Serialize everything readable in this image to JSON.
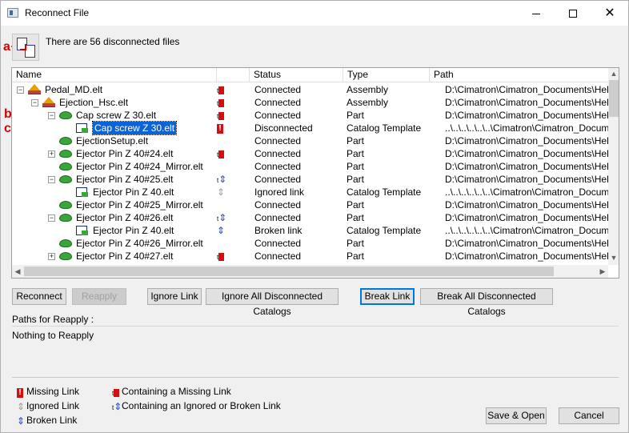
{
  "window": {
    "title": "Reconnect File",
    "minimize_glyph": "",
    "maximize_glyph": "",
    "close_glyph": "✕"
  },
  "annotations": {
    "a": "a",
    "b": "b",
    "c": "c"
  },
  "info_text": "There are 56 disconnected files",
  "columns": [
    "Name",
    "Status",
    "Type",
    "Path"
  ],
  "rows": [
    {
      "name": "Pedal_MD.elt",
      "level": 0,
      "expander": "−",
      "node_icon": "assembly-icon",
      "link_icon": "containing-missing-link-icon",
      "status": "Connected",
      "type": "Assembly",
      "path": "D:\\Cimatron\\Cimatron_Documents\\Help W"
    },
    {
      "name": "Ejection_Hsc.elt",
      "level": 1,
      "expander": "−",
      "node_icon": "assembly-icon",
      "link_icon": "containing-missing-link-icon",
      "status": "Connected",
      "type": "Assembly",
      "path": "D:\\Cimatron\\Cimatron_Documents\\Help W"
    },
    {
      "name": "Cap screw Z 30.elt",
      "level": 2,
      "expander": "−",
      "node_icon": "part-icon",
      "link_icon": "containing-missing-link-icon",
      "status": "Connected",
      "type": "Part",
      "path": "D:\\Cimatron\\Cimatron_Documents\\Help W"
    },
    {
      "name": "Cap screw Z 30.elt",
      "level": 3,
      "expander": "",
      "node_icon": "catalog-icon",
      "link_icon": "missing-link-icon",
      "status": "Disconnected",
      "type": "Catalog Template",
      "path": "..\\..\\..\\..\\..\\..\\Cimatron\\Cimatron_Documents\\Help W",
      "selected": true
    },
    {
      "name": "EjectionSetup.elt",
      "level": 2,
      "expander": "",
      "node_icon": "part-icon",
      "link_icon": "",
      "status": "Connected",
      "type": "Part",
      "path": "D:\\Cimatron\\Cimatron_Documents\\Help W"
    },
    {
      "name": "Ejector Pin Z 40#24.elt",
      "level": 2,
      "expander": "+",
      "node_icon": "part-icon",
      "link_icon": "containing-missing-link-icon",
      "status": "Connected",
      "type": "Part",
      "path": "D:\\Cimatron\\Cimatron_Documents\\Help W"
    },
    {
      "name": "Ejector Pin Z 40#24_Mirror.elt",
      "level": 2,
      "expander": "",
      "node_icon": "part-icon",
      "link_icon": "",
      "status": "Connected",
      "type": "Part",
      "path": "D:\\Cimatron\\Cimatron_Documents\\Help W"
    },
    {
      "name": "Ejector Pin Z 40#25.elt",
      "level": 2,
      "expander": "−",
      "node_icon": "part-icon",
      "link_icon": "containing-ignored-broken-link-icon",
      "status": "Connected",
      "type": "Part",
      "path": "D:\\Cimatron\\Cimatron_Documents\\Help W"
    },
    {
      "name": "Ejector Pin Z 40.elt",
      "level": 3,
      "expander": "",
      "node_icon": "catalog-icon",
      "link_icon": "ignored-link-icon",
      "status": "Ignored link",
      "type": "Catalog Template",
      "path": "..\\..\\..\\..\\..\\..\\Cimatron\\Cimatron_Documents\\Help W"
    },
    {
      "name": "Ejector Pin Z 40#25_Mirror.elt",
      "level": 2,
      "expander": "",
      "node_icon": "part-icon",
      "link_icon": "",
      "status": "Connected",
      "type": "Part",
      "path": "D:\\Cimatron\\Cimatron_Documents\\Help W"
    },
    {
      "name": "Ejector Pin Z 40#26.elt",
      "level": 2,
      "expander": "−",
      "node_icon": "part-icon",
      "link_icon": "containing-ignored-broken-link-icon",
      "status": "Connected",
      "type": "Part",
      "path": "D:\\Cimatron\\Cimatron_Documents\\Help W"
    },
    {
      "name": "Ejector Pin Z 40.elt",
      "level": 3,
      "expander": "",
      "node_icon": "catalog-icon",
      "link_icon": "broken-link-icon",
      "status": "Broken link",
      "type": "Catalog Template",
      "path": "..\\..\\..\\..\\..\\..\\Cimatron\\Cimatron_Documents\\Help W"
    },
    {
      "name": "Ejector Pin Z 40#26_Mirror.elt",
      "level": 2,
      "expander": "",
      "node_icon": "part-icon",
      "link_icon": "",
      "status": "Connected",
      "type": "Part",
      "path": "D:\\Cimatron\\Cimatron_Documents\\Help W"
    },
    {
      "name": "Ejector Pin Z 40#27.elt",
      "level": 2,
      "expander": "+",
      "node_icon": "part-icon",
      "link_icon": "containing-missing-link-icon",
      "status": "Connected",
      "type": "Part",
      "path": "D:\\Cimatron\\Cimatron_Documents\\Help W"
    }
  ],
  "buttons": {
    "reconnect": "Reconnect",
    "reapply": "Reapply",
    "ignore_link": "Ignore Link",
    "ignore_all": "Ignore All Disconnected Catalogs",
    "break_link": "Break Link",
    "break_all": "Break All Disconnected Catalogs",
    "save_open": "Save & Open",
    "cancel": "Cancel"
  },
  "paths_label": "Paths for Reapply :",
  "reapply_text": "Nothing to Reapply",
  "legend": {
    "missing": "Missing Link",
    "ignored": "Ignored Link",
    "broken": "Broken Link",
    "containing_missing": "Containing a Missing Link",
    "containing_ignored": "Containing an Ignored or Broken Link"
  }
}
